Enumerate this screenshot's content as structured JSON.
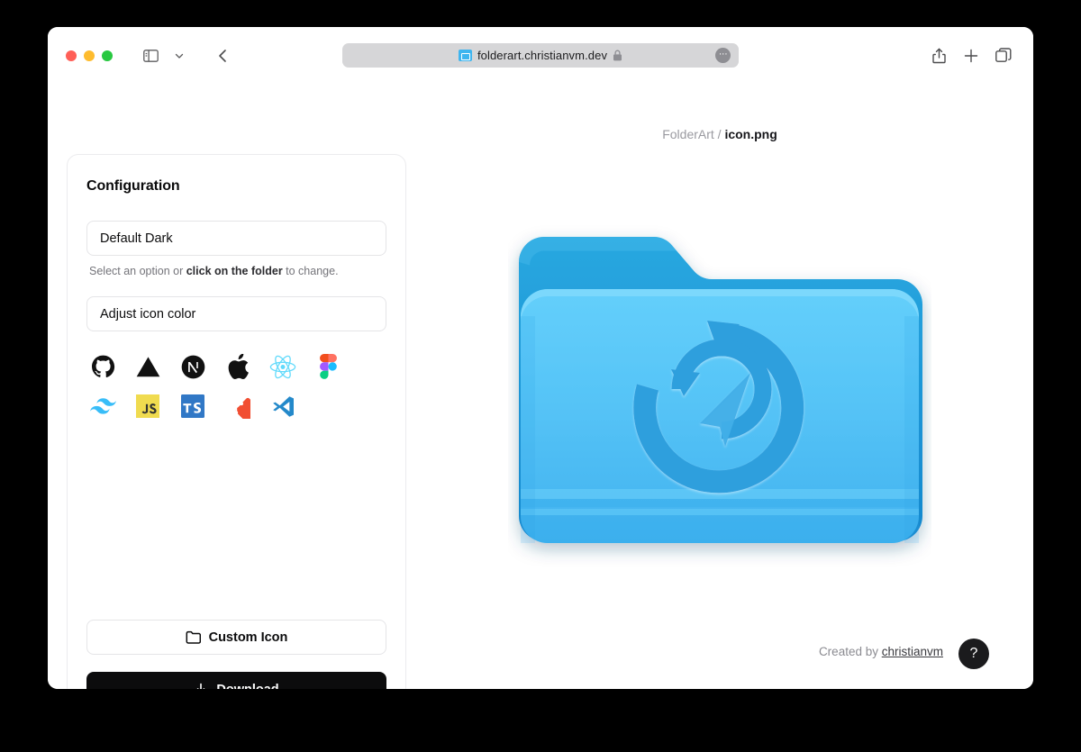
{
  "window": {
    "traffic_lights": [
      "close",
      "minimize",
      "maximize"
    ],
    "sidebar_toggle": "sidebar-toggle",
    "chevron": "chevron-down",
    "back": "back-arrow"
  },
  "url_bar": {
    "url": "folderart.christianvm.dev",
    "favicon": "folder-favicon",
    "lock": "lock-icon",
    "more": "···"
  },
  "toolbar_right": {
    "share": "share-icon",
    "new_tab": "plus-icon",
    "tabs": "tab-overview-icon"
  },
  "config": {
    "title": "Configuration",
    "preset_value": "Default Dark",
    "preset_options": [
      "Default Dark"
    ],
    "helper_prefix": "Select an option or ",
    "helper_bold": "click on the folder",
    "helper_suffix": " to change.",
    "color_value": "Adjust icon color",
    "icons": [
      {
        "name": "github-icon",
        "label": "GitHub"
      },
      {
        "name": "vercel-icon",
        "label": "Vercel"
      },
      {
        "name": "nextjs-icon",
        "label": "Next.js"
      },
      {
        "name": "apple-icon",
        "label": "Apple"
      },
      {
        "name": "react-icon",
        "label": "React"
      },
      {
        "name": "figma-icon",
        "label": "Figma"
      },
      {
        "name": "tailwind-icon",
        "label": "Tailwind CSS"
      },
      {
        "name": "javascript-icon",
        "label": "JS"
      },
      {
        "name": "typescript-icon",
        "label": "TS"
      },
      {
        "name": "git-icon",
        "label": "Git"
      },
      {
        "name": "vscode-icon",
        "label": "VS Code"
      }
    ],
    "custom_icon_label": "Custom Icon",
    "download_label": "Download"
  },
  "preview": {
    "breadcrumb_root": "FolderArt",
    "breadcrumb_separator": " / ",
    "breadcrumb_file": "icon.png",
    "folder": {
      "emblem": "refresh-navigation-icon",
      "back_color": "#1e9ad9",
      "front_color": "#59c6f8",
      "emblem_color": "#2f9fdd"
    }
  },
  "footer": {
    "credit_prefix": "Created by ",
    "credit_link": "christianvm",
    "help_label": "?"
  }
}
